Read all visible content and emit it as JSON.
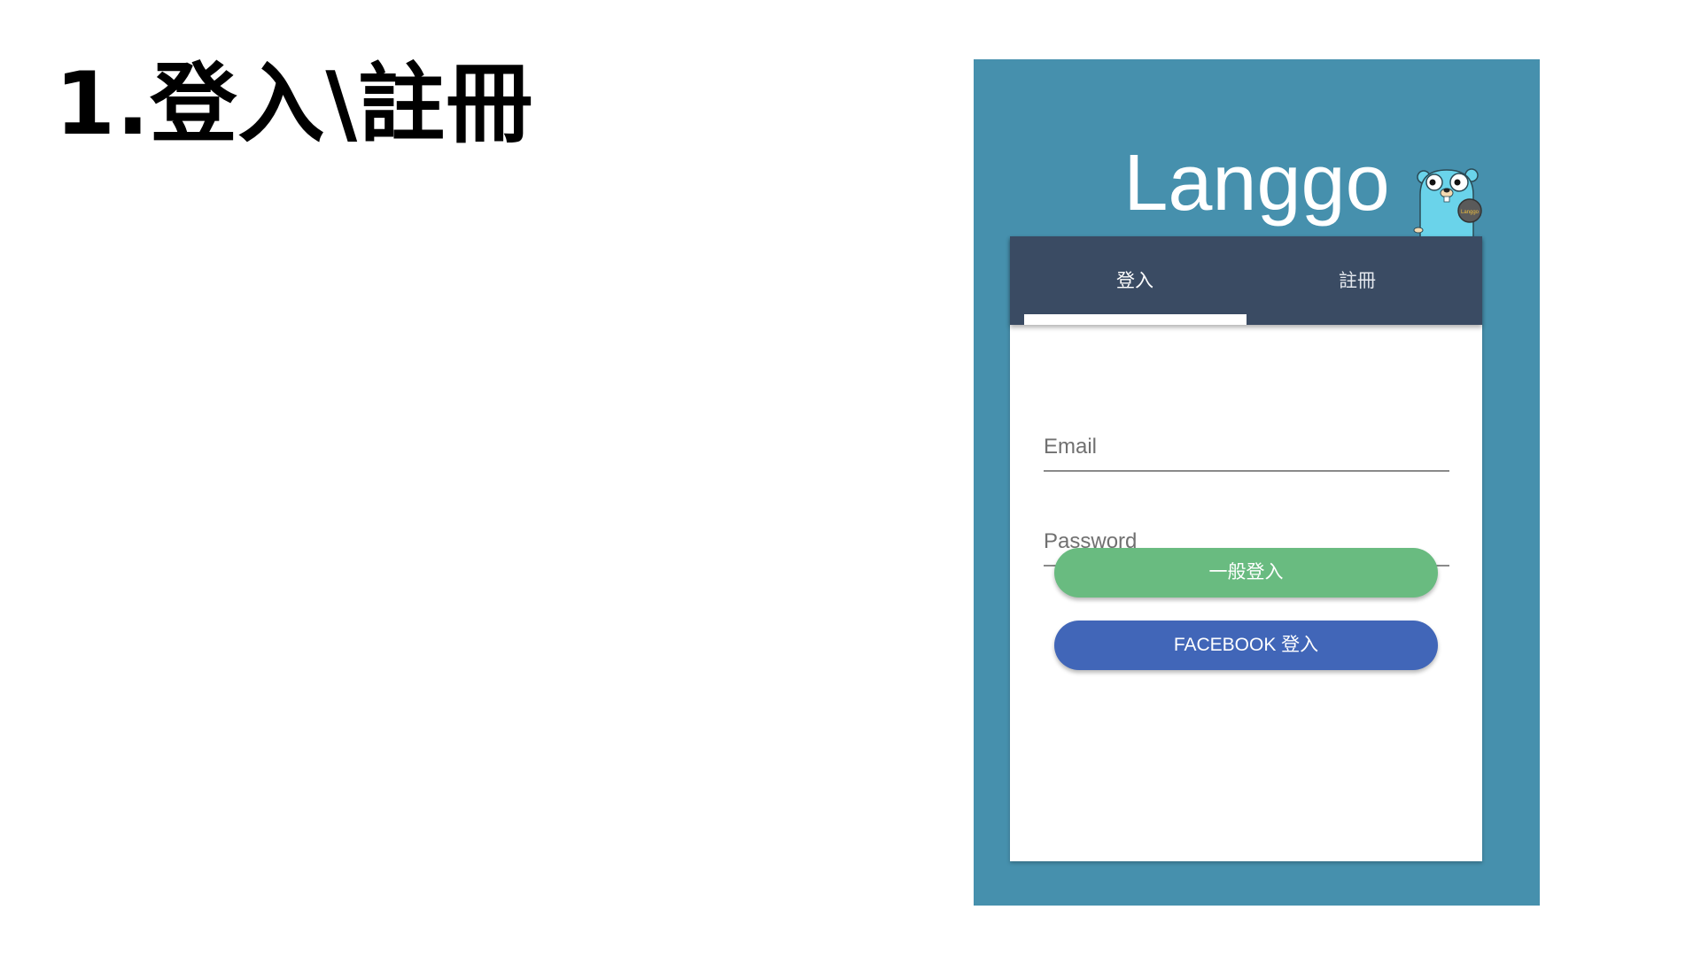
{
  "slide": {
    "title": "1.登入\\註冊"
  },
  "app": {
    "logo_text": "Langgo",
    "badge_text": "Langgo",
    "colors": {
      "frame": "#4690ad",
      "tab_bar": "#3a4b63",
      "login_button": "#69bb80",
      "facebook_button": "#4166b8",
      "mascot": "#6ad3ea"
    },
    "tabs": [
      {
        "label": "登入",
        "active": true
      },
      {
        "label": "註冊",
        "active": false
      }
    ],
    "form": {
      "email_placeholder": "Email",
      "email_value": "",
      "password_placeholder": "Password",
      "password_value": ""
    },
    "buttons": {
      "login_label": "一般登入",
      "facebook_label": "FACEBOOK 登入"
    },
    "icons": {
      "mascot": "gopher-mascot-icon"
    }
  }
}
